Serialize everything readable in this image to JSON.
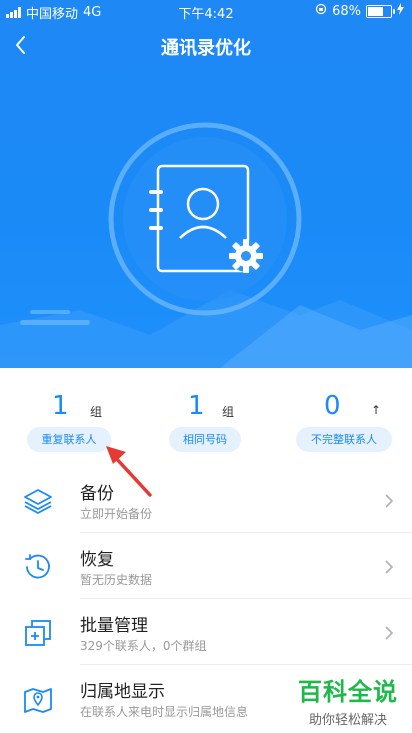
{
  "status_bar": {
    "carrier": "中国移动",
    "network": "4G",
    "time": "下午4:42",
    "battery_percent": "68%",
    "battery_level": 0.68
  },
  "nav": {
    "title": "通讯录优化"
  },
  "stats": [
    {
      "count": "1",
      "unit": "组",
      "label": "重复联系人"
    },
    {
      "count": "1",
      "unit": "组",
      "label": "相同号码"
    },
    {
      "count": "0",
      "unit": "↑",
      "label": "不完整联系人"
    }
  ],
  "list": [
    {
      "title": "备份",
      "subtitle": "立即开始备份",
      "icon": "layers-icon"
    },
    {
      "title": "恢复",
      "subtitle": "暂无历史数据",
      "icon": "history-clock-icon"
    },
    {
      "title": "批量管理",
      "subtitle": "329个联系人，0个群组",
      "icon": "batch-add-icon"
    },
    {
      "title": "归属地显示",
      "subtitle": "在联系人来电时显示归属地信息",
      "icon": "map-location-icon"
    }
  ],
  "watermark": {
    "main": "百科全说",
    "sub": "助你轻松解决"
  },
  "colors": {
    "primary": "#1a8af7",
    "pill_bg": "#e6f1fe",
    "arrow": "#e53935",
    "watermark": "#1fb84a"
  }
}
